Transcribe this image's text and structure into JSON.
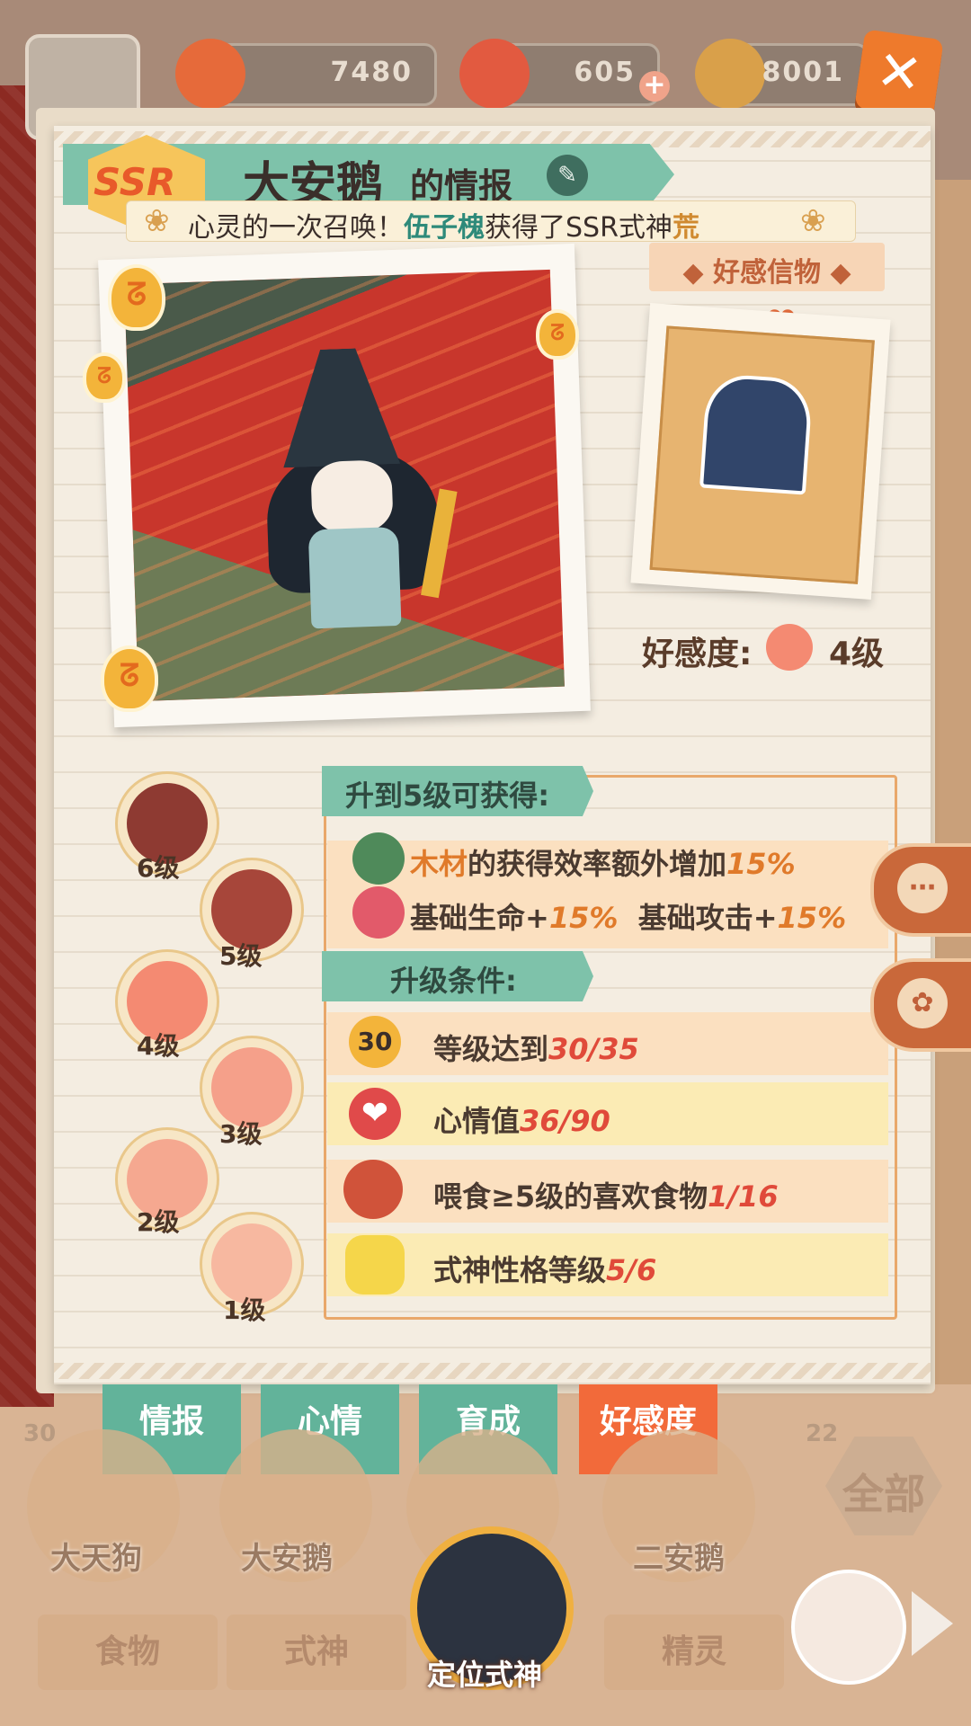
{
  "resources": [
    {
      "icon": "plum-coin-icon",
      "value": "7480"
    },
    {
      "icon": "nine-token-icon",
      "value": "605"
    },
    {
      "icon": "coin-icon",
      "value": "8001"
    }
  ],
  "header": {
    "rarity": "SSR",
    "name": "大安鹅",
    "title_suffix": "的情报",
    "marquee_prefix": "心灵的一次召唤！",
    "marquee_player": "伍子槐",
    "marquee_mid": "获得了SSR式神",
    "marquee_end": "荒"
  },
  "gift": {
    "title": "◆ 好感信物 ◆",
    "favor_label": "好感度:",
    "favor_level": "4级"
  },
  "levels": [
    "6级",
    "5级",
    "4级",
    "3级",
    "2级",
    "1级"
  ],
  "reward_section": {
    "title": "升到5级可获得:",
    "rewards": [
      {
        "icon": "wood-icon",
        "wood": "木材",
        "text": "的获得效率额外增加",
        "value": "15%"
      },
      {
        "icon": "sword-icon",
        "text1": "基础生命+",
        "value1": "15%",
        "text2": "基础攻击+",
        "value2": "15%"
      }
    ]
  },
  "condition_section": {
    "title": "升级条件:",
    "conditions": [
      {
        "icon": "level-30-icon",
        "icon_text": "30",
        "label": "等级达到",
        "value": "30/35"
      },
      {
        "icon": "heart-icon",
        "label": "心情值",
        "value": "36/90"
      },
      {
        "icon": "food-icon",
        "label": "喂食≥5级的喜欢食物",
        "value": "1/16"
      },
      {
        "icon": "duck-icon",
        "label": "式神性格等级",
        "value": "5/6"
      }
    ]
  },
  "tabs": [
    "情报",
    "心情",
    "育成",
    "好感度"
  ],
  "active_tab": "好感度",
  "roster": {
    "characters": [
      "大天狗",
      "大安鹅",
      "",
      "二安鹅"
    ],
    "badges": [
      "30",
      "22"
    ],
    "all_label": "全部"
  },
  "bottom_tabs": [
    "食物",
    "式神",
    "精灵"
  ],
  "locate_label": "定位式神",
  "colors": {
    "accent_green": "#7ec2aa",
    "accent_orange": "#f26a3a",
    "value_red": "#e04a3a"
  }
}
